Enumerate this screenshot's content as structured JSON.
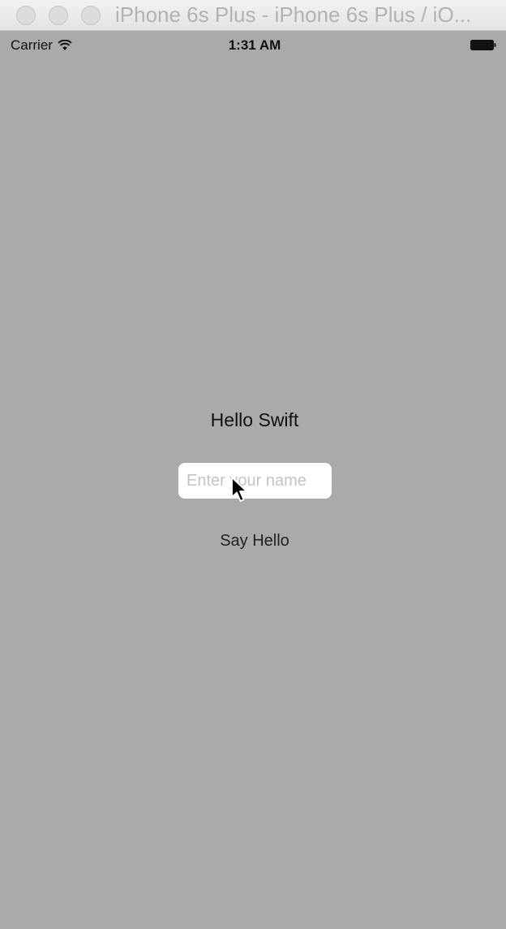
{
  "window": {
    "title": "iPhone 6s Plus - iPhone 6s Plus / iO..."
  },
  "statusbar": {
    "carrier": "Carrier",
    "time": "1:31 AM",
    "wifi_icon": "wifi-icon",
    "battery_icon": "battery-icon"
  },
  "main": {
    "hello_label": "Hello Swift",
    "name_field": {
      "value": "",
      "placeholder": "Enter your name"
    },
    "say_hello_button": "Say Hello"
  },
  "colors": {
    "background": "#aaaaaa",
    "field_background": "#ffffff",
    "placeholder": "#c4c4c4"
  }
}
